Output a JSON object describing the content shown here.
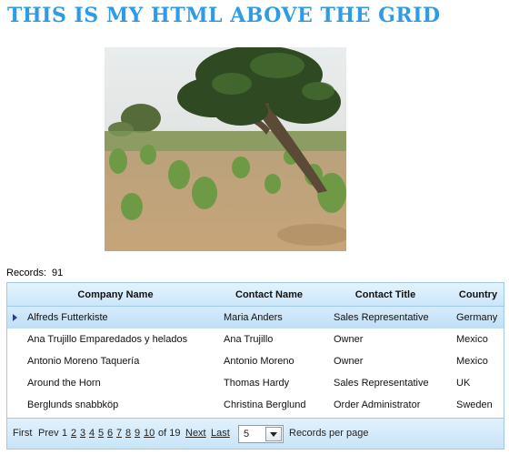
{
  "page": {
    "heading": "THIS IS MY HTML ABOVE THE GRID",
    "records_label": "Records:",
    "records_count": "91"
  },
  "grid": {
    "columns": [
      "Company Name",
      "Contact Name",
      "Contact Title",
      "Country"
    ],
    "rows": [
      {
        "company": "Alfreds Futterkiste",
        "contact": "Maria Anders",
        "title": "Sales Representative",
        "country": "Germany",
        "selected": true
      },
      {
        "company": "Ana Trujillo Emparedados y helados",
        "contact": "Ana Trujillo",
        "title": "Owner",
        "country": "Mexico"
      },
      {
        "company": "Antonio Moreno Taquería",
        "contact": "Antonio Moreno",
        "title": "Owner",
        "country": "Mexico"
      },
      {
        "company": "Around the Horn",
        "contact": "Thomas Hardy",
        "title": "Sales Representative",
        "country": "UK"
      },
      {
        "company": "Berglunds snabbköp",
        "contact": "Christina Berglund",
        "title": "Order Administrator",
        "country": "Sweden"
      }
    ]
  },
  "pager": {
    "first": "First",
    "prev": "Prev",
    "current_page": "1",
    "pages": [
      "2",
      "3",
      "4",
      "5",
      "6",
      "7",
      "8",
      "9",
      "10"
    ],
    "of_text": "of 19",
    "next": "Next",
    "last": "Last",
    "page_size": "5",
    "page_size_label": "Records per page"
  },
  "icons": {
    "row_indicator": "triangle-right-icon",
    "dropdown": "chevron-down-icon"
  },
  "colors": {
    "heading": "#2e9be6",
    "grid_border": "#9ec9ea",
    "selected_row": "#c9e4f9"
  }
}
